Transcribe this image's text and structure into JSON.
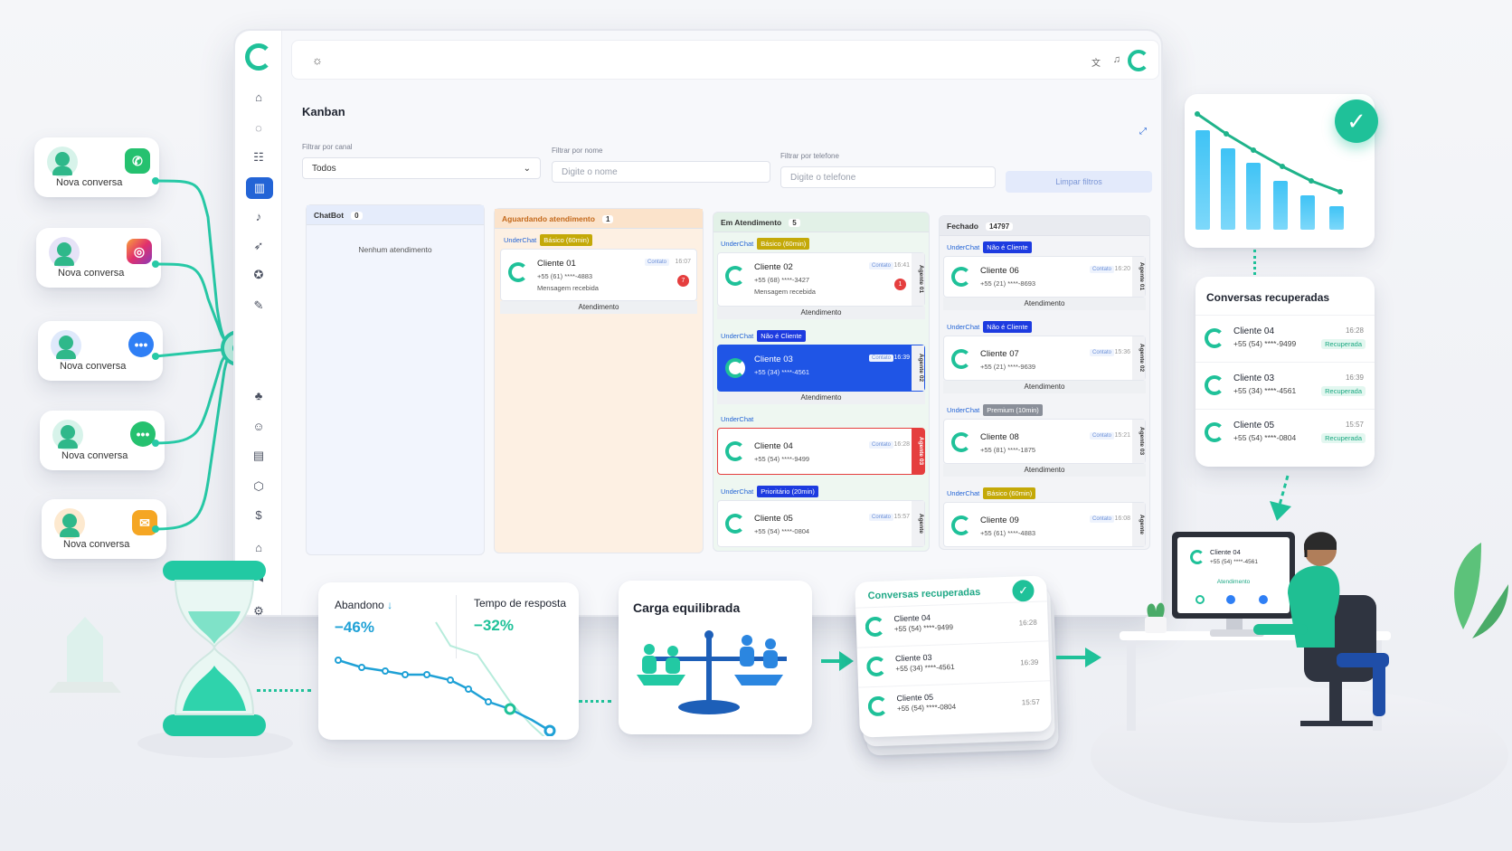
{
  "channels": [
    {
      "label": "Nova conversa",
      "icon": "whatsapp-icon",
      "color": "#25c16f"
    },
    {
      "label": "Nova conversa",
      "icon": "instagram-icon",
      "color": "#e1306c"
    },
    {
      "label": "Nova conversa",
      "icon": "messenger-icon",
      "color": "#2f7ff5"
    },
    {
      "label": "Nova conversa",
      "icon": "chat-icon",
      "color": "#25c16f"
    },
    {
      "label": "Nova conversa",
      "icon": "email-icon",
      "color": "#f5a623"
    }
  ],
  "app": {
    "title": "Kanban",
    "filters": {
      "canal_label": "Filtrar por canal",
      "canal_value": "Todos",
      "nome_label": "Filtrar por nome",
      "nome_placeholder": "Digite o nome",
      "telefone_label": "Filtrar por telefone",
      "telefone_placeholder": "Digite o telefone",
      "clear_label": "Limpar filtros"
    },
    "columns": [
      {
        "title": "ChatBot",
        "count": "0",
        "empty": "Nenhum atendimento"
      },
      {
        "title": "Aguardando atendimento",
        "count": "1"
      },
      {
        "title": "Em Atendimento",
        "count": "5"
      },
      {
        "title": "Fechado",
        "count": "14797"
      }
    ],
    "waiting_cards": [
      {
        "uc": "UnderChat",
        "tag": "Básico (60min)",
        "name": "Cliente 01",
        "phone": "+55 (61) ****-4883",
        "msg": "Mensagem recebida",
        "contato": "Contato",
        "time": "16:07",
        "badge": "7",
        "footer": "Atendimento"
      }
    ],
    "active_cards": [
      {
        "uc": "UnderChat",
        "tag": "Básico (60min)",
        "name": "Cliente 02",
        "phone": "+55 (68) ****-3427",
        "msg": "Mensagem recebida",
        "contato": "Contato",
        "time": "16:41",
        "badge": "1",
        "agent": "Agente 01",
        "footer": "Atendimento"
      },
      {
        "uc": "UnderChat",
        "tag": "Não é Cliente",
        "name": "Cliente 03",
        "phone": "+55 (34) ****-4561",
        "contato": "Contato",
        "time": "16:39",
        "agent": "Agente 02",
        "footer": "Atendimento"
      },
      {
        "uc": "UnderChat",
        "name": "Cliente 04",
        "phone": "+55 (54) ****-9499",
        "contato": "Contato",
        "time": "16:28",
        "agent": "Agente 03"
      },
      {
        "uc": "UnderChat",
        "tag": "Prioritário (20min)",
        "name": "Cliente 05",
        "phone": "+55 (54) ****-0804",
        "contato": "Contato",
        "time": "15:57",
        "agent": "Agente"
      }
    ],
    "closed_cards": [
      {
        "uc": "UnderChat",
        "tag": "Não é Cliente",
        "name": "Cliente 06",
        "phone": "+55 (21) ****-8693",
        "contato": "Contato",
        "time": "16:20",
        "agent": "Agente 01",
        "footer": "Atendimento"
      },
      {
        "uc": "UnderChat",
        "tag": "Não é Cliente",
        "name": "Cliente 07",
        "phone": "+55 (21) ****-9639",
        "contato": "Contato",
        "time": "15:36",
        "agent": "Agente 02",
        "footer": "Atendimento"
      },
      {
        "uc": "UnderChat",
        "tag": "Premium (10min)",
        "name": "Cliente 08",
        "phone": "+55 (81) ****-1875",
        "contato": "Contato",
        "time": "15:21",
        "agent": "Agente 03",
        "footer": "Atendimento"
      },
      {
        "uc": "UnderChat",
        "tag": "Básico (60min)",
        "name": "Cliente 09",
        "phone": "+55 (61) ****-4883",
        "contato": "Contato",
        "time": "16:08",
        "agent": "Agente"
      }
    ]
  },
  "recovered": {
    "title": "Conversas recuperadas",
    "status": "Recuperada",
    "items": [
      {
        "name": "Cliente 04",
        "phone": "+55 (54) ****-9499",
        "time": "16:28"
      },
      {
        "name": "Cliente 03",
        "phone": "+55 (34) ****-4561",
        "time": "16:39"
      },
      {
        "name": "Cliente 05",
        "phone": "+55 (54) ****-0804",
        "time": "15:57"
      }
    ]
  },
  "metrics": {
    "abandono_label": "Abandono",
    "abandono_value": "−46%",
    "resposta_label": "Tempo de resposta",
    "resposta_value": "−32%",
    "carga_label": "Carga equilibrada"
  },
  "stack": {
    "title": "Conversas recuperadas",
    "items": [
      {
        "name": "Cliente 04",
        "phone": "+55 (54) ****-9499",
        "time": "16:28"
      },
      {
        "name": "Cliente 03",
        "phone": "+55 (34) ****-4561",
        "time": "16:39"
      },
      {
        "name": "Cliente 05",
        "phone": "+55 (54) ****-0804",
        "time": "15:57"
      }
    ]
  },
  "monitor": {
    "name": "Cliente 04",
    "phone": "+55 (54) ****-4561",
    "status": "Atendimento"
  },
  "colors": {
    "accent": "#1fc199",
    "blue": "#2364d6",
    "red": "#e53e3e"
  }
}
